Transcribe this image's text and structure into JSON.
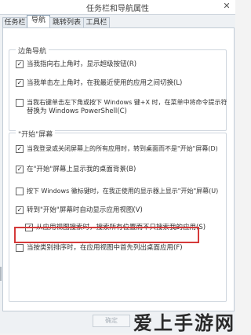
{
  "window": {
    "title": "任务栏和导航属性",
    "close_glyph": "✕"
  },
  "tabs": [
    {
      "label": "任务栏",
      "active": false
    },
    {
      "label": "导航",
      "active": true
    },
    {
      "label": "跳转列表",
      "active": false
    },
    {
      "label": "工具栏",
      "active": false
    }
  ],
  "corner_nav": {
    "title": "边角导航",
    "options": [
      {
        "label": "当我指向右上角时，显示超级按钮(R)",
        "checked": true
      },
      {
        "label": "当我单击左上角时，在我最近使用的应用之间切换(L)",
        "checked": true
      },
      {
        "label": "当我右键单击左下角或按下 Windows 键+X 时，在菜单中将命令提示符",
        "label_cont": "替换为 Windows PowerShell(C)",
        "checked": false
      }
    ]
  },
  "start_screen": {
    "title": "\"开始\"屏幕",
    "options": [
      {
        "label": "当我登录或关闭屏幕上的所有应用时，转到桌面而不是\"开始\"屏幕(D)",
        "checked": true
      },
      {
        "label": "在\"开始\"屏幕上显示我的桌面背景(B)",
        "checked": true
      },
      {
        "label": "按下 Windows 徽标键时，在我正使用的显示器上显示\"开始\"屏幕(U)",
        "checked": false
      },
      {
        "label": "转到\"开始\"屏幕时自动显示应用视图(V)",
        "checked": true
      },
      {
        "label": "从应用视图搜索时，搜索所有位置而不只搜索我的应用(S)",
        "checked": true
      },
      {
        "label": "当按类别排序时，在应用视图中首先列出桌面应用(F)",
        "checked": false
      }
    ]
  },
  "buttons": {
    "ok": "确定"
  },
  "watermark": "爱上手游网",
  "colors": {
    "highlight_border": "#d53a3a"
  }
}
